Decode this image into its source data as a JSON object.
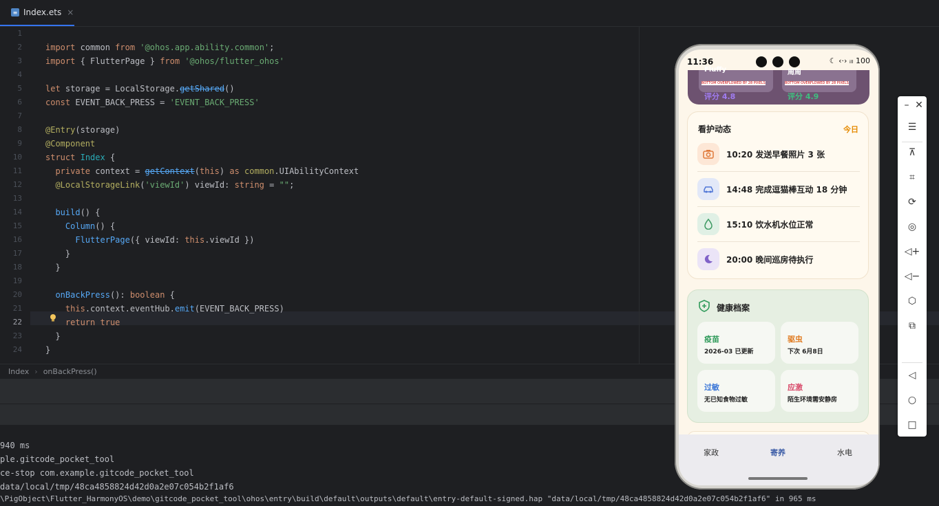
{
  "ide": {
    "tab": {
      "filename": "Index.ets",
      "close": "×"
    },
    "line_numbers": [
      "1",
      "2",
      "3",
      "4",
      "5",
      "6",
      "7",
      "8",
      "9",
      "10",
      "11",
      "12",
      "13",
      "14",
      "15",
      "16",
      "17",
      "18",
      "19",
      "20",
      "21",
      "22",
      "23",
      "24"
    ],
    "breadcrumb": [
      "Index",
      "onBackPress()"
    ],
    "console_lines": [
      "940 ms",
      "ple.gitcode_pocket_tool",
      "ce-stop com.example.gitcode_pocket_tool",
      "data/local/tmp/48ca4858824d42d0a2e07c054b2f1af6",
      "\\PigObject\\Flutter_HarmonyOS\\demo\\gitcode_pocket_tool\\ohos\\entry\\build\\default\\outputs\\default\\entry-default-signed.hap \"data/local/tmp/48ca4858824d42d0a2e07c054b2f1af6\" in 965 ms"
    ]
  },
  "phone": {
    "status": {
      "time": "11:36",
      "right": "☾ ‹·› ᵢₗₗ 100"
    },
    "top_pets": [
      {
        "name": "Fluffy",
        "rating": "评分 4.8",
        "rating_color": "#a07cf0"
      },
      {
        "name": "周周",
        "rating": "评分 4.9",
        "rating_color": "#3fbf7f"
      }
    ],
    "overflow_text": "BOTTOM OVERFLOWED BY 28 PIXELS",
    "care": {
      "title": "看护动态",
      "today": "今日",
      "items": [
        {
          "text": "10:20 发送早餐照片 3 张",
          "icon": "camera-icon",
          "bg": "#fde7d6",
          "fg": "#e07a3a"
        },
        {
          "text": "14:48 完成逗猫棒互动 18 分钟",
          "icon": "car-toy-icon",
          "bg": "#e2e8f8",
          "fg": "#4f76d6"
        },
        {
          "text": "15:10 饮水机水位正常",
          "icon": "water-drop-icon",
          "bg": "#e0f0e5",
          "fg": "#3e9a63"
        },
        {
          "text": "20:00 晚间巡房待执行",
          "icon": "moon-icon",
          "bg": "#ebe4f7",
          "fg": "#8062c8"
        }
      ]
    },
    "health": {
      "title": "健康档案",
      "cells": [
        {
          "label": "疫苗",
          "sub": "2026-03 已更新",
          "color": "#2f9a5a"
        },
        {
          "label": "驱虫",
          "sub": "下次 6月8日",
          "color": "#e07a1f"
        },
        {
          "label": "过敏",
          "sub": "无已知食物过敏",
          "color": "#3d78d8"
        },
        {
          "label": "应激",
          "sub": "陌生环境需安静房",
          "color": "#d84a6a"
        }
      ]
    },
    "nav": [
      {
        "label": "家政",
        "active": false
      },
      {
        "label": "寄养",
        "active": true
      },
      {
        "label": "水电",
        "active": false
      }
    ]
  },
  "emulator_toolbar": [
    "minimize-icon",
    "close-icon",
    "menu-icon",
    "pin-top-icon",
    "crop-icon",
    "rotate-icon",
    "screenshot-icon",
    "volume-up-icon",
    "volume-down-icon",
    "shake-icon",
    "multi-device-icon",
    "back-icon",
    "home-icon",
    "recent-icon"
  ]
}
